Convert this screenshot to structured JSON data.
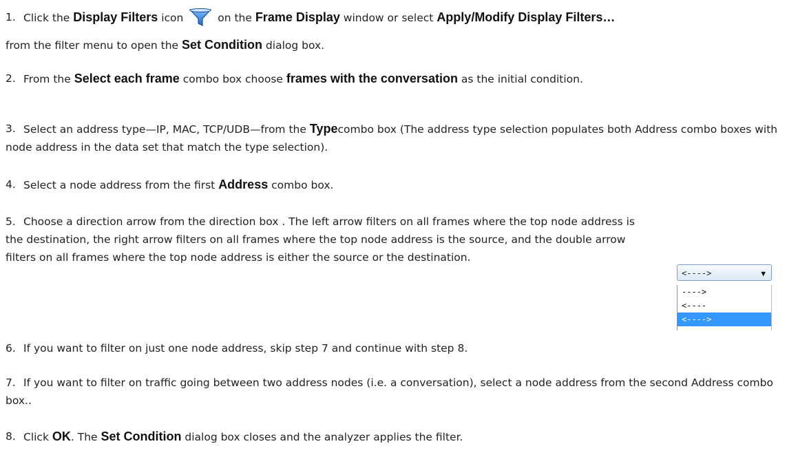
{
  "steps": [
    {
      "num": "1.",
      "parts": [
        {
          "t": "Click the "
        },
        {
          "t": "Display Filters",
          "b": true
        },
        {
          "t": " icon "
        },
        {
          "icon": "display-filter-icon"
        },
        {
          "t": " on the "
        },
        {
          "t": "Frame Display",
          "b": true
        },
        {
          "t": " window or select "
        },
        {
          "t": "Apply/Modify Display Filters…",
          "b": true
        },
        {
          "t": " from the filter menu to open the "
        },
        {
          "t": "Set Condition",
          "b": true
        },
        {
          "t": " dialog box."
        }
      ]
    },
    {
      "num": "2.",
      "parts": [
        {
          "t": "From the "
        },
        {
          "t": "Select each frame",
          "b": true
        },
        {
          "t": " combo box choose "
        },
        {
          "t": "frames with the conversation",
          "b": true
        },
        {
          "t": " as the initial condition."
        }
      ]
    },
    {
      "num": "3.",
      "parts": [
        {
          "t": "Select an address type—IP, MAC, TCP/UDB—from the "
        },
        {
          "t": "Type",
          "b": true
        },
        {
          "t": "combo box (The address type selection populates both Address combo boxes with node address in the data set that match the type selection)."
        }
      ]
    },
    {
      "num": "4.",
      "parts": [
        {
          "t": "Select a node address from the first "
        },
        {
          "t": "Address",
          "b": true
        },
        {
          "t": " combo box."
        }
      ]
    },
    {
      "num": "5.",
      "parts": [
        {
          "t": "Choose a direction arrow from the direction box . The left arrow filters on all frames where the top node address is the destination, the right arrow filters on all frames where  the top node address is the source, and the double arrow filters on all frames where the top node address is either the source or the destination."
        }
      ]
    },
    {
      "num": "6.",
      "parts": [
        {
          "t": "If you want to filter on just one node address, skip step 7 and continue with step 8."
        }
      ]
    },
    {
      "num": "7.",
      "parts": [
        {
          "t": "If you want to filter on traffic going between two address nodes (i.e. a conversation), select a node address from the second Address combo box.."
        }
      ]
    },
    {
      "num": "8.",
      "parts": [
        {
          "t": "Click "
        },
        {
          "t": "OK",
          "b": true
        },
        {
          "t": ". The "
        },
        {
          "t": "Set Condition",
          "b": true
        },
        {
          "t": " dialog box closes and the analyzer applies the filter."
        }
      ]
    }
  ],
  "direction_combo": {
    "selected": "<---->",
    "options": [
      "---->",
      "<----",
      "<---->"
    ],
    "selected_index": 2,
    "arrow_icon": "dropdown-triangle-icon"
  },
  "colors": {
    "text": "#222222",
    "selection": "#3399ff",
    "icon_funnel": "#2f7fd6"
  }
}
